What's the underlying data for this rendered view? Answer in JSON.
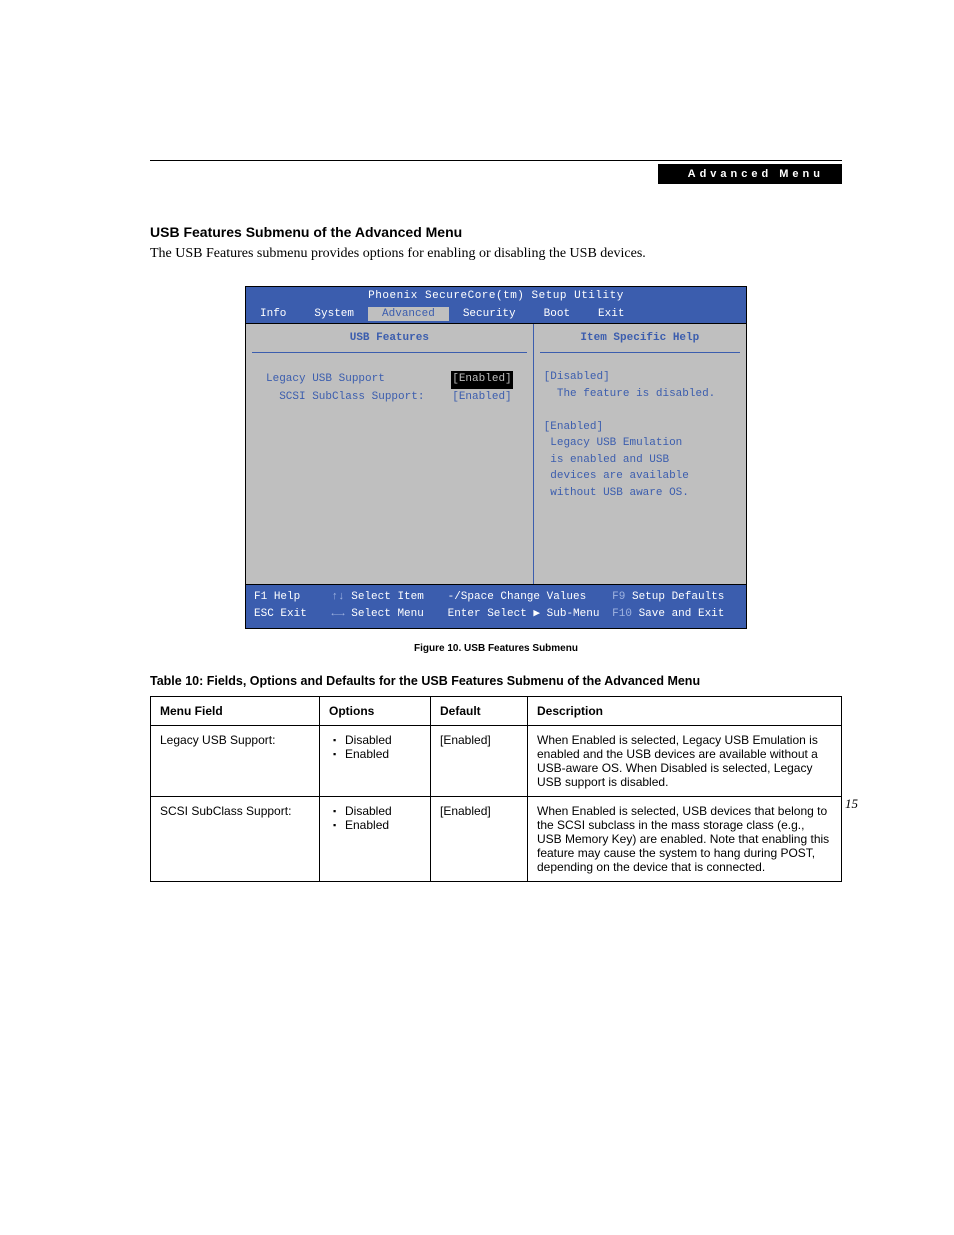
{
  "header": {
    "bar_label": "Advanced Menu"
  },
  "section": {
    "title": "USB Features Submenu of the Advanced Menu",
    "intro": "The USB Features submenu provides options for enabling or disabling the USB devices."
  },
  "bios": {
    "title": "Phoenix SecureCore(tm) Setup Utility",
    "tabs": [
      "Info",
      "System",
      "Advanced",
      "Security",
      "Boot",
      "Exit"
    ],
    "active_tab": "Advanced",
    "left_title": "USB Features",
    "right_title": "Item Specific Help",
    "options": [
      {
        "label": "Legacy USB Support",
        "value": "[Enabled]",
        "selected": true
      },
      {
        "label": "SCSI SubClass Support:",
        "value": "[Enabled]",
        "selected": false,
        "indent": true
      }
    ],
    "help_text": "[Disabled]\n  The feature is disabled.\n\n[Enabled]\n Legacy USB Emulation\n is enabled and USB\n devices are available\n without USB aware OS.",
    "footer": {
      "row1": [
        {
          "key": "F1",
          "text": "Help",
          "dim": false
        },
        {
          "key": "↑↓",
          "text": "Select Item",
          "dim": true
        },
        {
          "key": "-/Space",
          "text": "Change Values",
          "dim": false
        },
        {
          "key": "F9",
          "text": "Setup Defaults",
          "dim": true
        }
      ],
      "row2": [
        {
          "key": "ESC",
          "text": "Exit",
          "dim": false
        },
        {
          "key": "←→",
          "text": "Select Menu",
          "dim": true
        },
        {
          "key": "Enter",
          "text": "Select ▶ Sub-Menu",
          "dim": false
        },
        {
          "key": "F10",
          "text": "Save and Exit",
          "dim": true
        }
      ]
    }
  },
  "figure_caption": "Figure 10.  USB Features Submenu",
  "table_title": "Table 10: Fields, Options and Defaults for the USB Features Submenu of the Advanced Menu",
  "table": {
    "headers": [
      "Menu Field",
      "Options",
      "Default",
      "Description"
    ],
    "rows": [
      {
        "field": "Legacy USB Support:",
        "options": [
          "Disabled",
          "Enabled"
        ],
        "default": "[Enabled]",
        "description": "When Enabled is selected, Legacy USB Emulation is enabled and the USB devices are available without a USB-aware OS. When Disabled is selected, Legacy USB support is disabled."
      },
      {
        "field": "SCSI SubClass Support:",
        "options": [
          "Disabled",
          "Enabled"
        ],
        "default": "[Enabled]",
        "description": "When Enabled is selected, USB devices that belong to the SCSI subclass in the mass storage class (e.g., USB Memory Key) are enabled. Note that enabling this feature may cause the system to hang during POST, depending on the device that is connected."
      }
    ]
  },
  "page_number": "15"
}
